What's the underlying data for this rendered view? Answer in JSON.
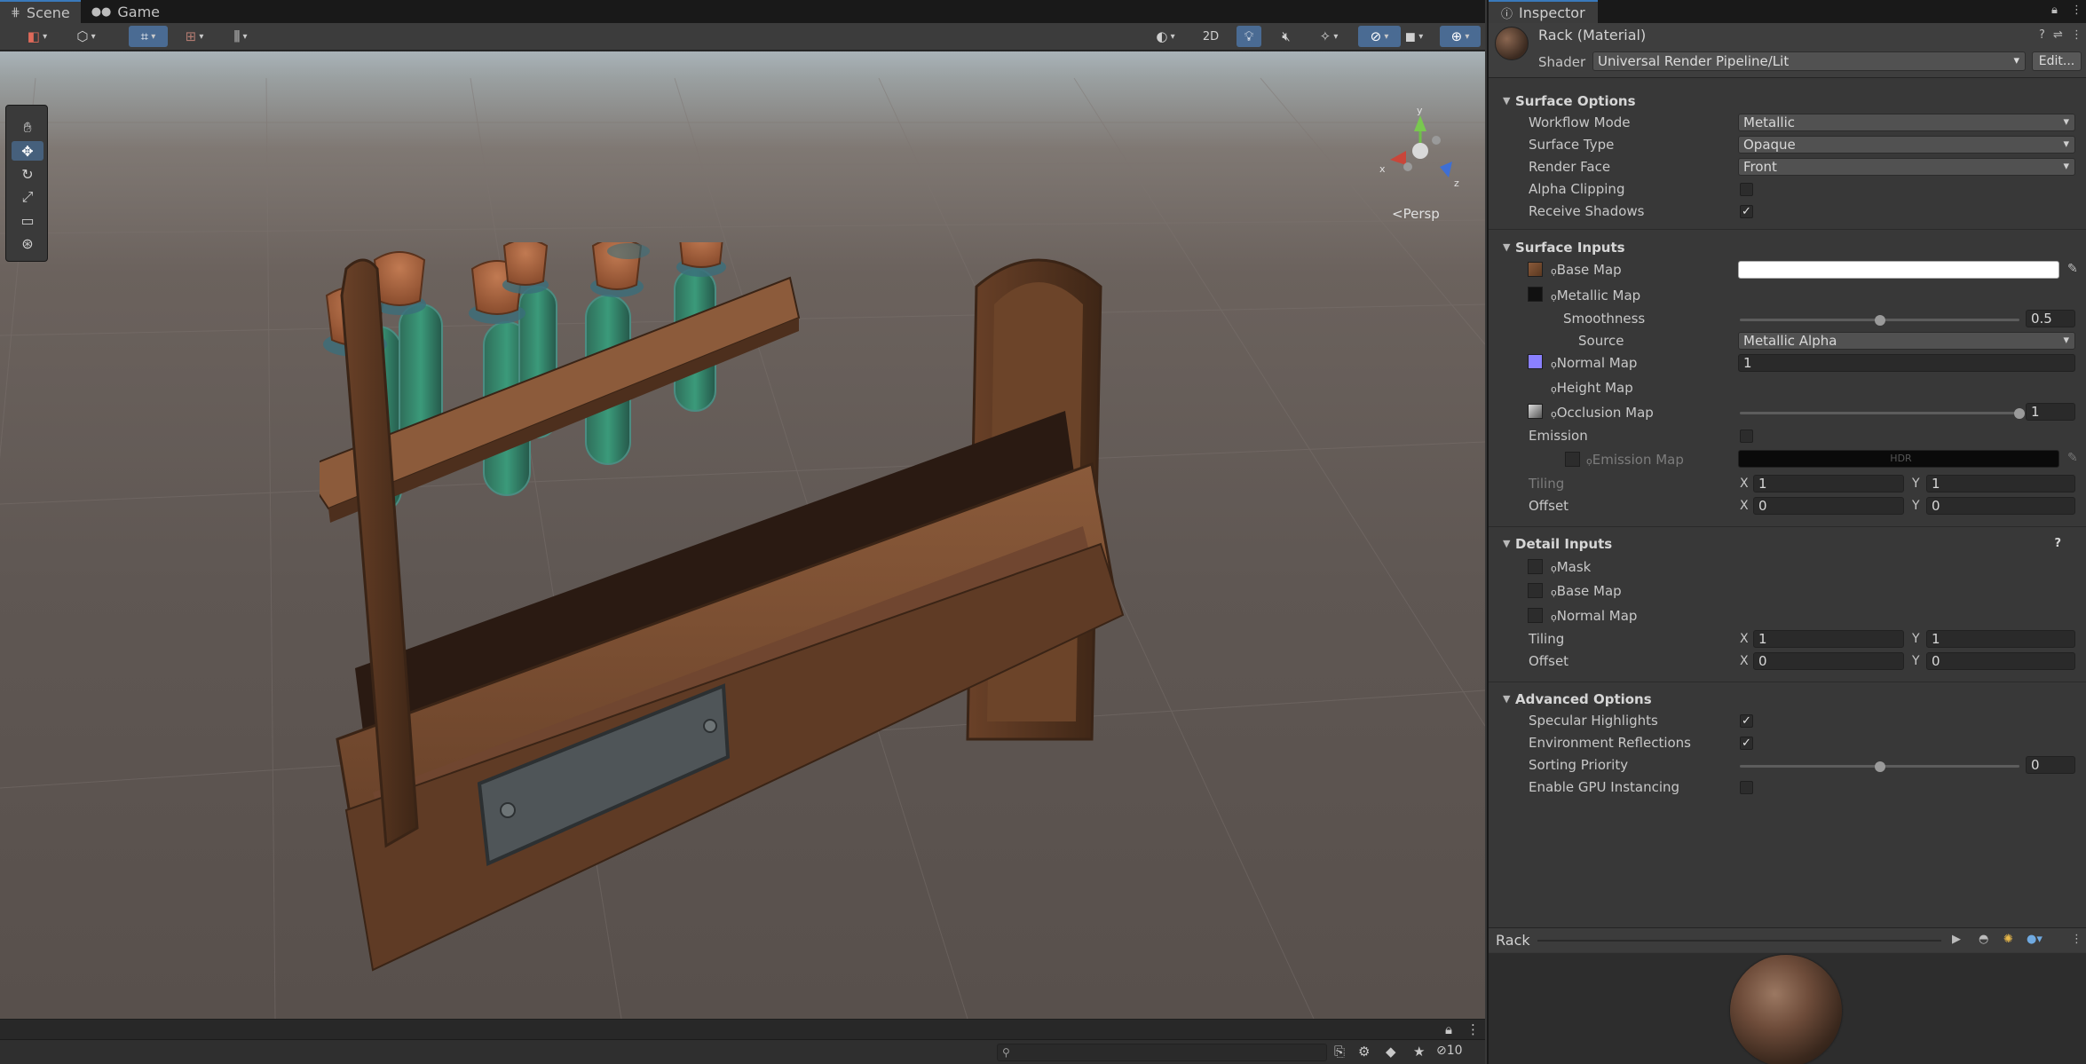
{
  "scene_tabs": [
    {
      "label": "Scene",
      "icon": "grid-icon"
    },
    {
      "label": "Game",
      "icon": "gamepad-icon"
    }
  ],
  "scene_toolbar": {
    "mode_2d": "2D",
    "persp_label": "Persp",
    "axes": {
      "x": "x",
      "y": "y",
      "z": "z"
    }
  },
  "tools": [
    "hand-tool",
    "move-tool",
    "rotate-tool",
    "scale-tool",
    "rect-tool",
    "transform-tool"
  ],
  "status": {
    "search_placeholder": "",
    "badge_count": "10"
  },
  "inspector": {
    "tab": "Inspector",
    "material_name": "Rack (Material)",
    "shader_label": "Shader",
    "shader_value": "Universal Render Pipeline/Lit",
    "edit_label": "Edit...",
    "surface_options": {
      "title": "Surface Options",
      "workflow_mode": {
        "label": "Workflow Mode",
        "value": "Metallic"
      },
      "surface_type": {
        "label": "Surface Type",
        "value": "Opaque"
      },
      "render_face": {
        "label": "Render Face",
        "value": "Front"
      },
      "alpha_clipping": {
        "label": "Alpha Clipping",
        "checked": false
      },
      "receive_shadows": {
        "label": "Receive Shadows",
        "checked": true
      }
    },
    "surface_inputs": {
      "title": "Surface Inputs",
      "base_map": "Base Map",
      "metallic_map": "Metallic Map",
      "smoothness": {
        "label": "Smoothness",
        "value": "0.5",
        "fraction": 0.5
      },
      "source": {
        "label": "Source",
        "value": "Metallic Alpha"
      },
      "normal_map": {
        "label": "Normal Map",
        "value": "1"
      },
      "height_map": "Height Map",
      "occlusion_map": {
        "label": "Occlusion Map",
        "value": "1",
        "fraction": 1.0
      },
      "emission": "Emission",
      "emission_map": "Emission Map",
      "hdr": "HDR",
      "tiling": {
        "label": "Tiling",
        "x": "1",
        "y": "1"
      },
      "offset": {
        "label": "Offset",
        "x": "0",
        "y": "0"
      }
    },
    "detail_inputs": {
      "title": "Detail Inputs",
      "mask": "Mask",
      "base_map": "Base Map",
      "normal_map": "Normal Map",
      "tiling": {
        "label": "Tiling",
        "x": "1",
        "y": "1"
      },
      "offset": {
        "label": "Offset",
        "x": "0",
        "y": "0"
      }
    },
    "advanced_options": {
      "title": "Advanced Options",
      "specular_highlights": {
        "label": "Specular Highlights",
        "checked": true
      },
      "environment_reflections": {
        "label": "Environment Reflections",
        "checked": true
      },
      "sorting_priority": {
        "label": "Sorting Priority",
        "value": "0",
        "fraction": 0.5
      },
      "gpu_instancing": {
        "label": "Enable GPU Instancing",
        "checked": false
      }
    },
    "preview_title": "Rack",
    "xy_x": "X",
    "xy_y": "Y"
  }
}
